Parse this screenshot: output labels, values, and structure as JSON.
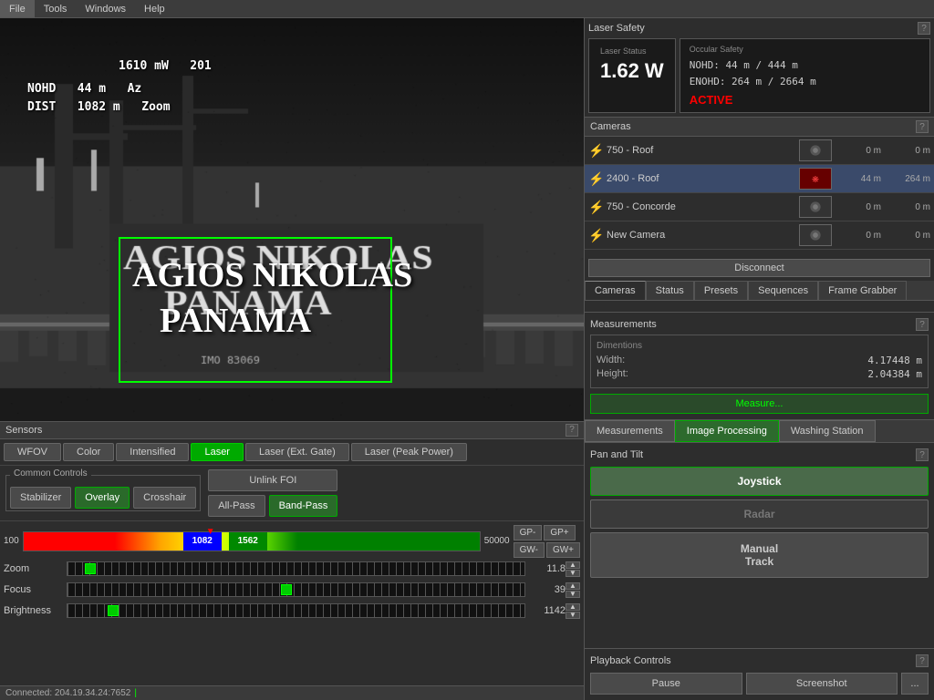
{
  "menu": {
    "items": [
      "File",
      "Tools",
      "Windows",
      "Help"
    ]
  },
  "video": {
    "overlay": {
      "nohd_label": "NOHD",
      "nohd_value": "44 m",
      "dist_label": "DIST",
      "dist_value": "1082 m",
      "power": "1610 mW",
      "code": "201",
      "az_label": "Az",
      "zoom_label": "Zoom"
    },
    "ship_name_line1": "AGIOS NIKOLAS",
    "ship_name_line2": "PANAMA"
  },
  "laser_safety": {
    "title": "Laser Safety",
    "laser_status_label": "Laser Status",
    "ocular_safety_label": "Occular Safety",
    "power": "1.62 W",
    "nohd": "NOHD:     44 m / 444 m",
    "enohd": "ENOHD: 264 m / 2664 m",
    "active": "ACTIVE",
    "help": "?"
  },
  "cameras": {
    "title": "Cameras",
    "help": "?",
    "items": [
      {
        "name": "750 - Roof",
        "bolt": "⚡",
        "active": false,
        "dist1": "0 m",
        "dist2": "0 m"
      },
      {
        "name": "2400 - Roof",
        "bolt": "⚡",
        "active": true,
        "dist1": "44 m",
        "dist2": "264 m"
      },
      {
        "name": "750 - Concorde",
        "bolt": "⚡",
        "active": false,
        "dist1": "0 m",
        "dist2": "0 m"
      },
      {
        "name": "New Camera",
        "bolt": "⚡",
        "active": false,
        "dist1": "0 m",
        "dist2": "0 m"
      }
    ],
    "disconnect_label": "Disconnect"
  },
  "camera_tabs": {
    "tabs": [
      "Cameras",
      "Status",
      "Presets",
      "Sequences",
      "Frame Grabber"
    ]
  },
  "measurements": {
    "title": "Measurements",
    "help": "?",
    "dimensions_label": "Dimentions",
    "width_label": "Width:",
    "width_value": "4.17448 m",
    "height_label": "Height:",
    "height_value": "2.04384 m",
    "measure_btn": "Measure..."
  },
  "bottom_tabs": {
    "tabs": [
      "Measurements",
      "Image Processing",
      "Washing Station"
    ]
  },
  "sensors": {
    "title": "Sensors",
    "help": "?",
    "modes": [
      "WFOV",
      "Color",
      "Intensified",
      "Laser",
      "Laser (Ext. Gate)",
      "Laser (Peak Power)"
    ],
    "active_mode": "Laser",
    "common_controls": "Common Controls",
    "buttons": [
      "Stabilizer",
      "Overlay",
      "Crosshair",
      "Unlink FOI",
      "All-Pass",
      "Band-Pass"
    ],
    "active_buttons": [
      "Overlay",
      "Band-Pass"
    ],
    "power_min": "100",
    "power_max": "50000",
    "marker1": "1082",
    "marker2": "1562",
    "sliders": [
      {
        "label": "Zoom",
        "value": "11.8",
        "position": 5
      },
      {
        "label": "Focus",
        "value": "39",
        "position": 48
      },
      {
        "label": "Brightness",
        "value": "1142",
        "position": 10
      }
    ],
    "gp_minus": "GP-",
    "gp_plus": "GP+",
    "gw_minus": "GW-",
    "gw_plus": "GW+"
  },
  "pan_tilt": {
    "title": "Pan and Tilt",
    "help": "?",
    "joystick_label": "Joystick",
    "radar_label": "Radar",
    "manual_track_label": "Manual\nTrack"
  },
  "playback": {
    "title": "Playback Controls",
    "help": "?",
    "pause_label": "Pause",
    "screenshot_label": "Screenshot",
    "more_label": "..."
  },
  "status_bar": {
    "connected": "Connected: 204.19.34.24:7652"
  }
}
